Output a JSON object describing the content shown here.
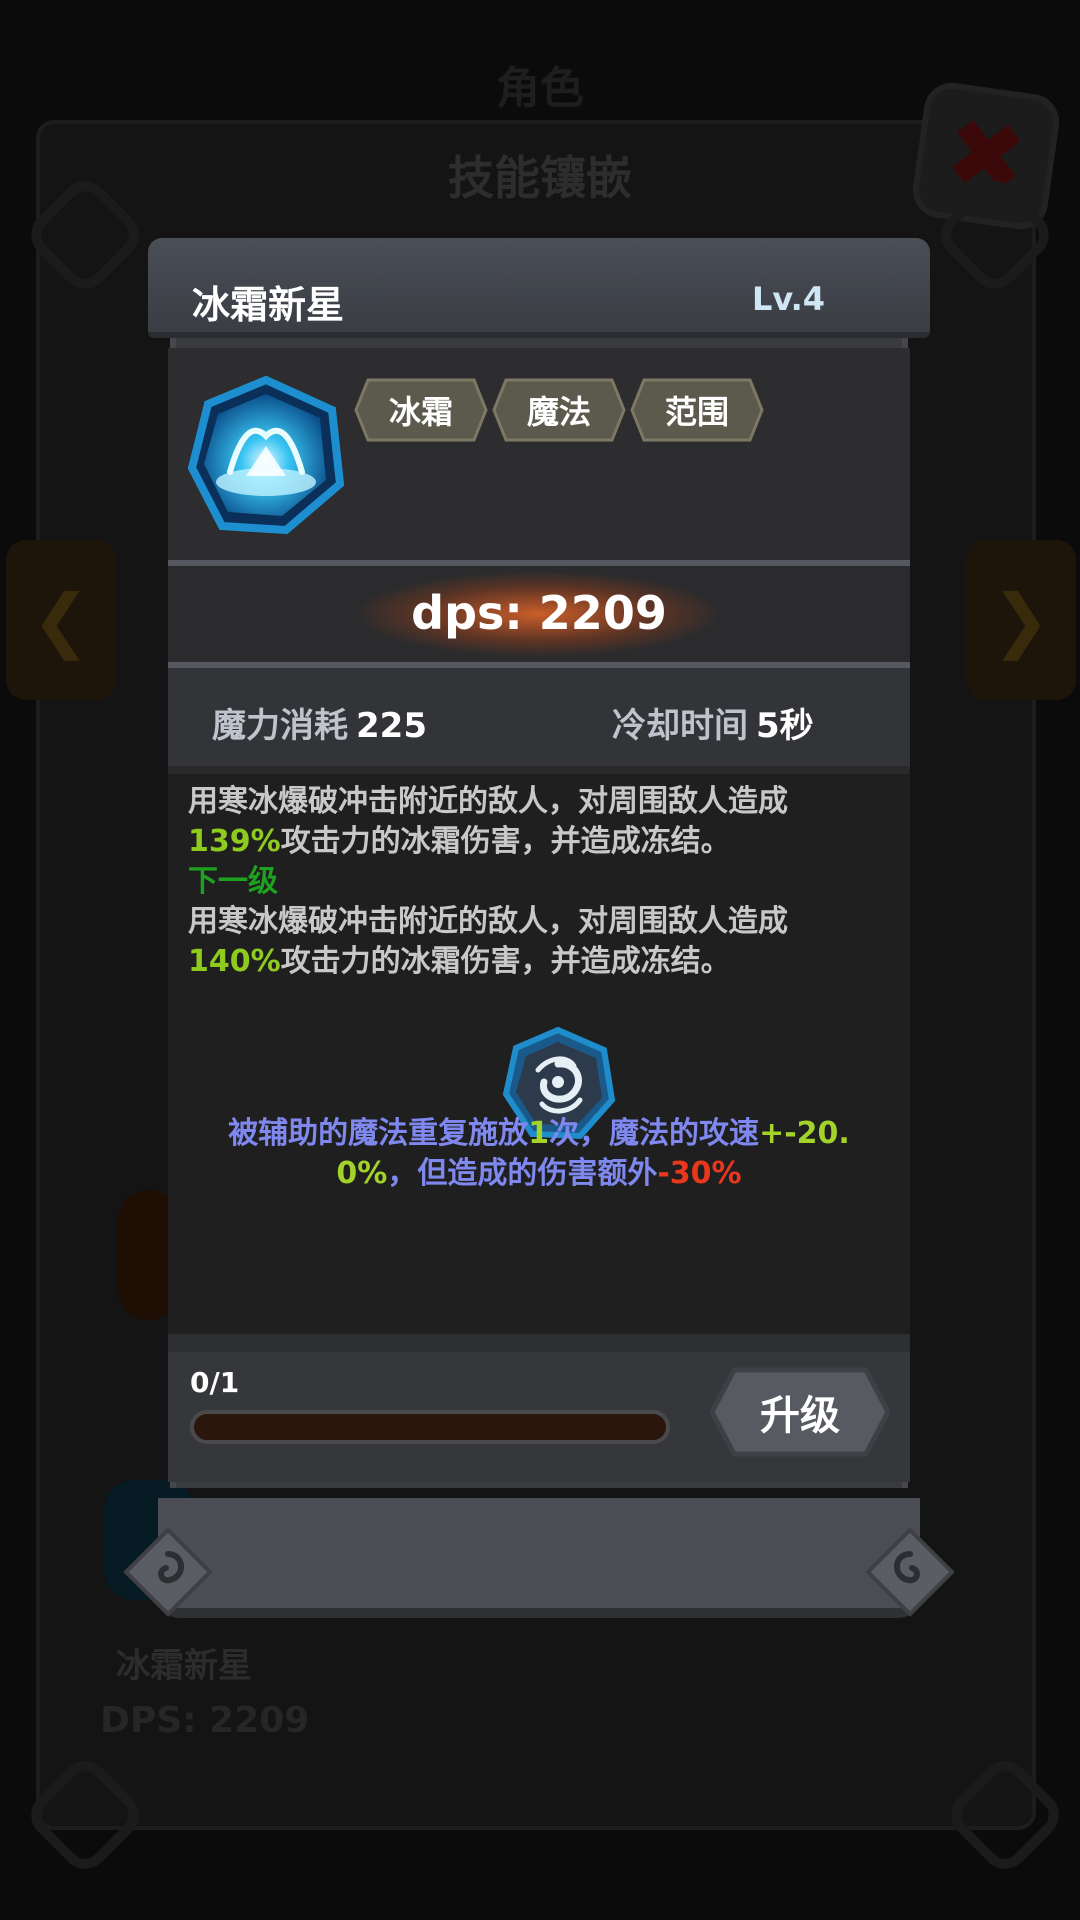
{
  "background": {
    "top_title": "角色",
    "sub_title": "技能镶嵌",
    "close_glyph": "✖",
    "skill_name": "冰霜新星",
    "dps_text": "DPS:  2209"
  },
  "modal": {
    "title": "冰霜新星",
    "level": "Lv.4",
    "icon": "frost-nova-icon",
    "tags": [
      "冰霜",
      "魔法",
      "范围"
    ],
    "dps": "dps: 2209",
    "mana_cost_label": "魔力消耗",
    "mana_cost_value": "225",
    "cooldown_label": "冷却时间",
    "cooldown_value": "5秒",
    "desc_current_a": "用寒冰爆破冲击附近的敌人，对周围敌人造成",
    "desc_current_pct": "139%",
    "desc_current_b": "攻击力的冰霜伤害，并造成冻结。",
    "next_level_label": "下一级",
    "desc_next_a": "用寒冰爆破冲击附近的敌人，对周围敌人造成",
    "desc_next_pct": "140%",
    "desc_next_b": "攻击力的冰霜伤害，并造成冻结。",
    "support_icon": "vortex-icon",
    "support_a": "被辅助的魔法重复施放",
    "support_num1": "1",
    "support_b": "次，魔法的攻速",
    "support_num2_line1": "+-20.",
    "support_num2_line2": "0%",
    "support_c": "，但造成的伤害额外",
    "support_neg": "-30%",
    "upgrade_progress_text": "0/1",
    "upgrade_progress": 0,
    "upgrade_button": "升级"
  },
  "colors": {
    "highlight_green": "#8ecb1e",
    "next_level_green": "#1ea11e",
    "support_blue": "#7f88ee",
    "negative_red": "#e8371c"
  }
}
